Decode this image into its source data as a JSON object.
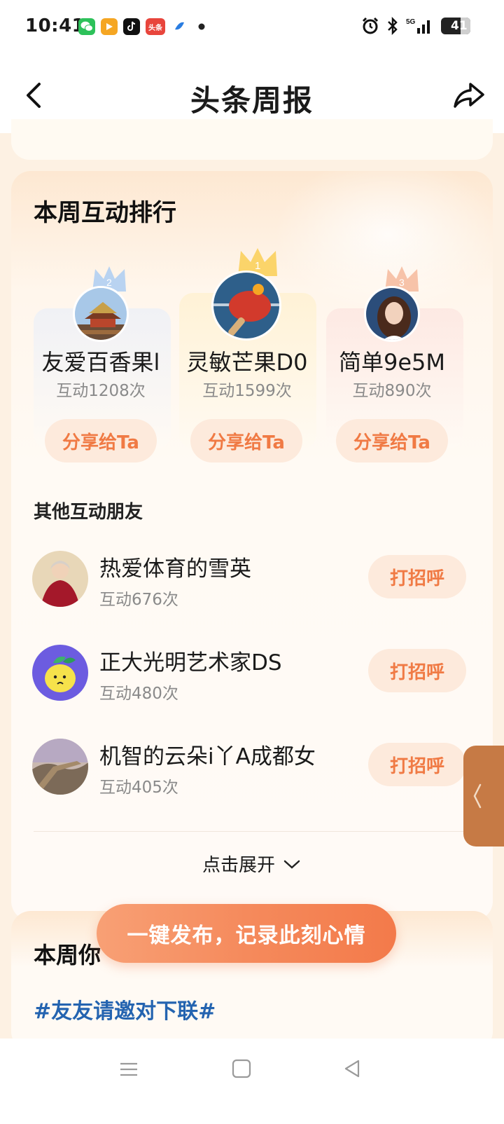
{
  "status_bar": {
    "time": "10:41",
    "app_icons": [
      "wechat-icon",
      "video-app-icon",
      "tiktok-icon",
      "toutiao-icon",
      "browser-icon",
      "dot-icon"
    ],
    "app_badge_toutiao": "头条",
    "battery": "41",
    "network": "5G"
  },
  "header": {
    "title": "头条周报"
  },
  "ranking": {
    "title": "本周互动排行",
    "top": [
      {
        "rank": "2",
        "name": "友爱百香果l",
        "count": "互动1208次",
        "button": "分享给Ta"
      },
      {
        "rank": "1",
        "name": "灵敏芒果D0",
        "count": "互动1599次",
        "button": "分享给Ta"
      },
      {
        "rank": "3",
        "name": "简单9e5M",
        "count": "互动890次",
        "button": "分享给Ta"
      }
    ],
    "other_title": "其他互动朋友",
    "others": [
      {
        "name": "热爱体育的雪英",
        "count": "互动676次",
        "button": "打招呼"
      },
      {
        "name": "正大光明艺术家DS",
        "count": "互动480次",
        "button": "打招呼"
      },
      {
        "name": "机智的云朵i丫A成都女",
        "count": "互动405次",
        "button": "打招呼"
      }
    ],
    "expand_label": "点击展开"
  },
  "next_section": {
    "title": "本周你",
    "hashtag": "#友友请邀对下联#"
  },
  "publish_button": "一键发布，记录此刻心情",
  "colors": {
    "accent": "#f07a44",
    "pill_bg": "#fdeadc",
    "hashtag": "#2464b0",
    "publish_gradient_start": "#f8a075",
    "publish_gradient_end": "#f37a4a"
  }
}
